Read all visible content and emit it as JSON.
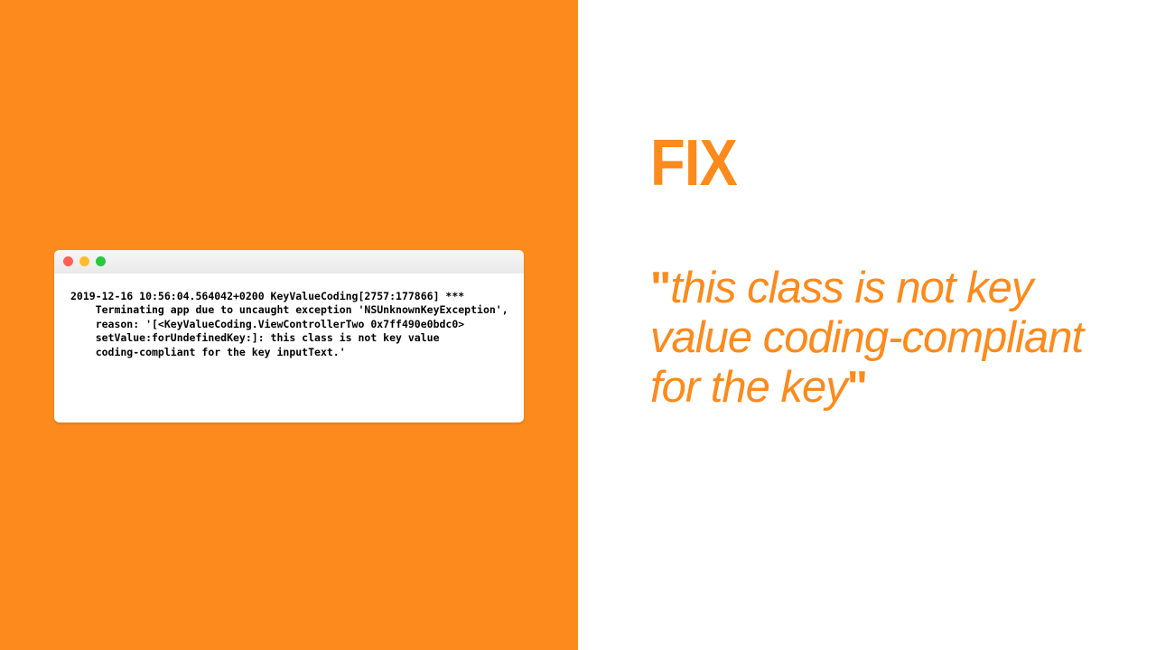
{
  "terminal": {
    "log_line1": "2019-12-16 10:56:04.564042+0200 KeyValueCoding[2757:177866] ***",
    "log_line2": "    Terminating app due to uncaught exception 'NSUnknownKeyException',",
    "log_line3": "    reason: '[<KeyValueCoding.ViewControllerTwo 0x7ff490e0bdc0>",
    "log_line4": "    setValue:forUndefinedKey:]: this class is not key value",
    "log_line5": "    coding-compliant for the key inputText.'"
  },
  "headline": "FIX",
  "quote": {
    "open": "\"",
    "body": "this class is not key value coding-compliant for the key",
    "close": "\""
  },
  "colors": {
    "accent": "#FC8A1C",
    "traffic_red": "#FF5F57",
    "traffic_yellow": "#FEBC2E",
    "traffic_green": "#28C840"
  }
}
